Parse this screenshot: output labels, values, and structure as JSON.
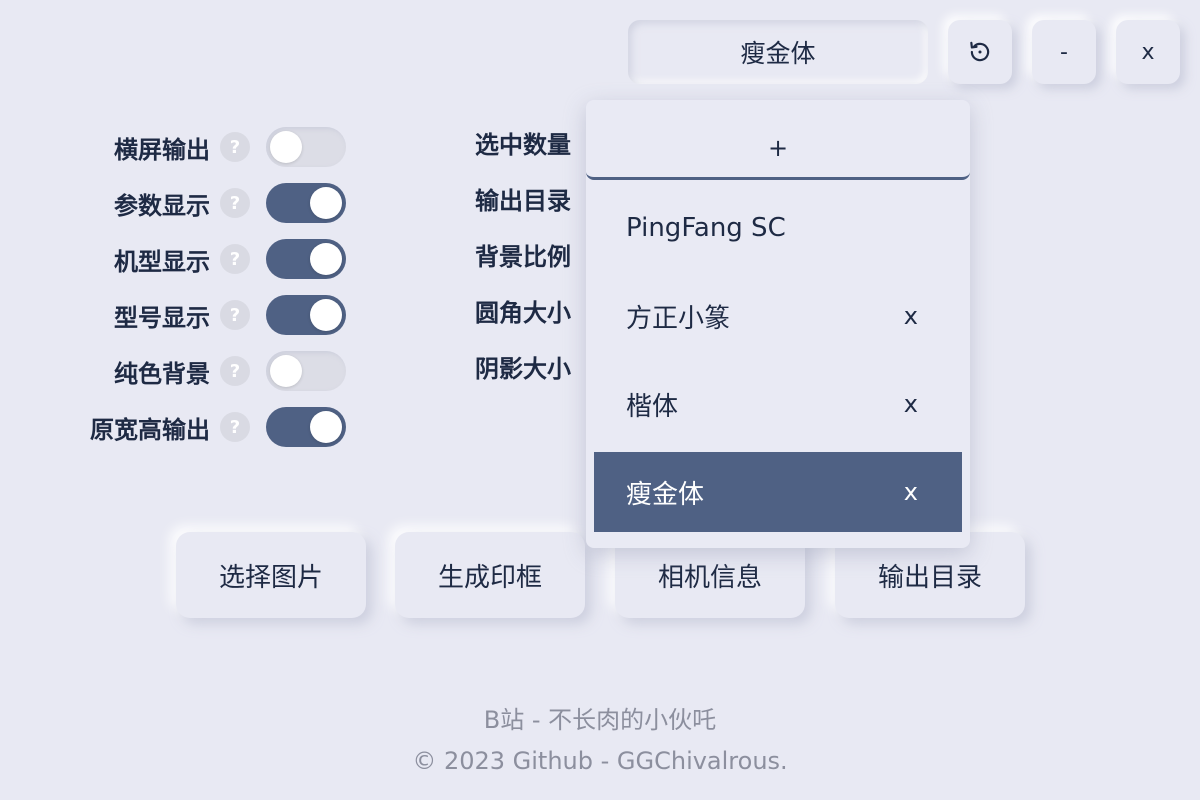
{
  "header": {
    "font_selected": "瘦金体",
    "reset_label": "↺",
    "minimize_label": "-",
    "close_label": "x"
  },
  "toggles": [
    {
      "label": "横屏输出",
      "help": "?",
      "on": false
    },
    {
      "label": "参数显示",
      "help": "?",
      "on": true
    },
    {
      "label": "机型显示",
      "help": "?",
      "on": true
    },
    {
      "label": "型号显示",
      "help": "?",
      "on": true
    },
    {
      "label": "纯色背景",
      "help": "?",
      "on": false
    },
    {
      "label": "原宽高输出",
      "help": "?",
      "on": true
    }
  ],
  "settings_labels": [
    "选中数量",
    "输出目录",
    "背景比例",
    "圆角大小",
    "阴影大小"
  ],
  "font_dropdown": {
    "add_label": "+",
    "items": [
      {
        "name": "PingFang SC",
        "delete": ""
      },
      {
        "name": "方正小篆",
        "delete": "x"
      },
      {
        "name": "楷体",
        "delete": "x"
      },
      {
        "name": "瘦金体",
        "delete": "x"
      }
    ],
    "selected_index": 3
  },
  "actions": {
    "select_image": "选择图片",
    "generate_frame": "生成印框",
    "camera_info": "相机信息",
    "output_dir": "输出目录"
  },
  "footer": {
    "line1": "B站 - 不长肉的小伙吒",
    "line2": "© 2023 Github - GGChivalrous."
  },
  "colors": {
    "accent": "#4f6184",
    "background": "#e8e9f3",
    "text": "#1e2a44",
    "muted": "#8c8f9e"
  }
}
